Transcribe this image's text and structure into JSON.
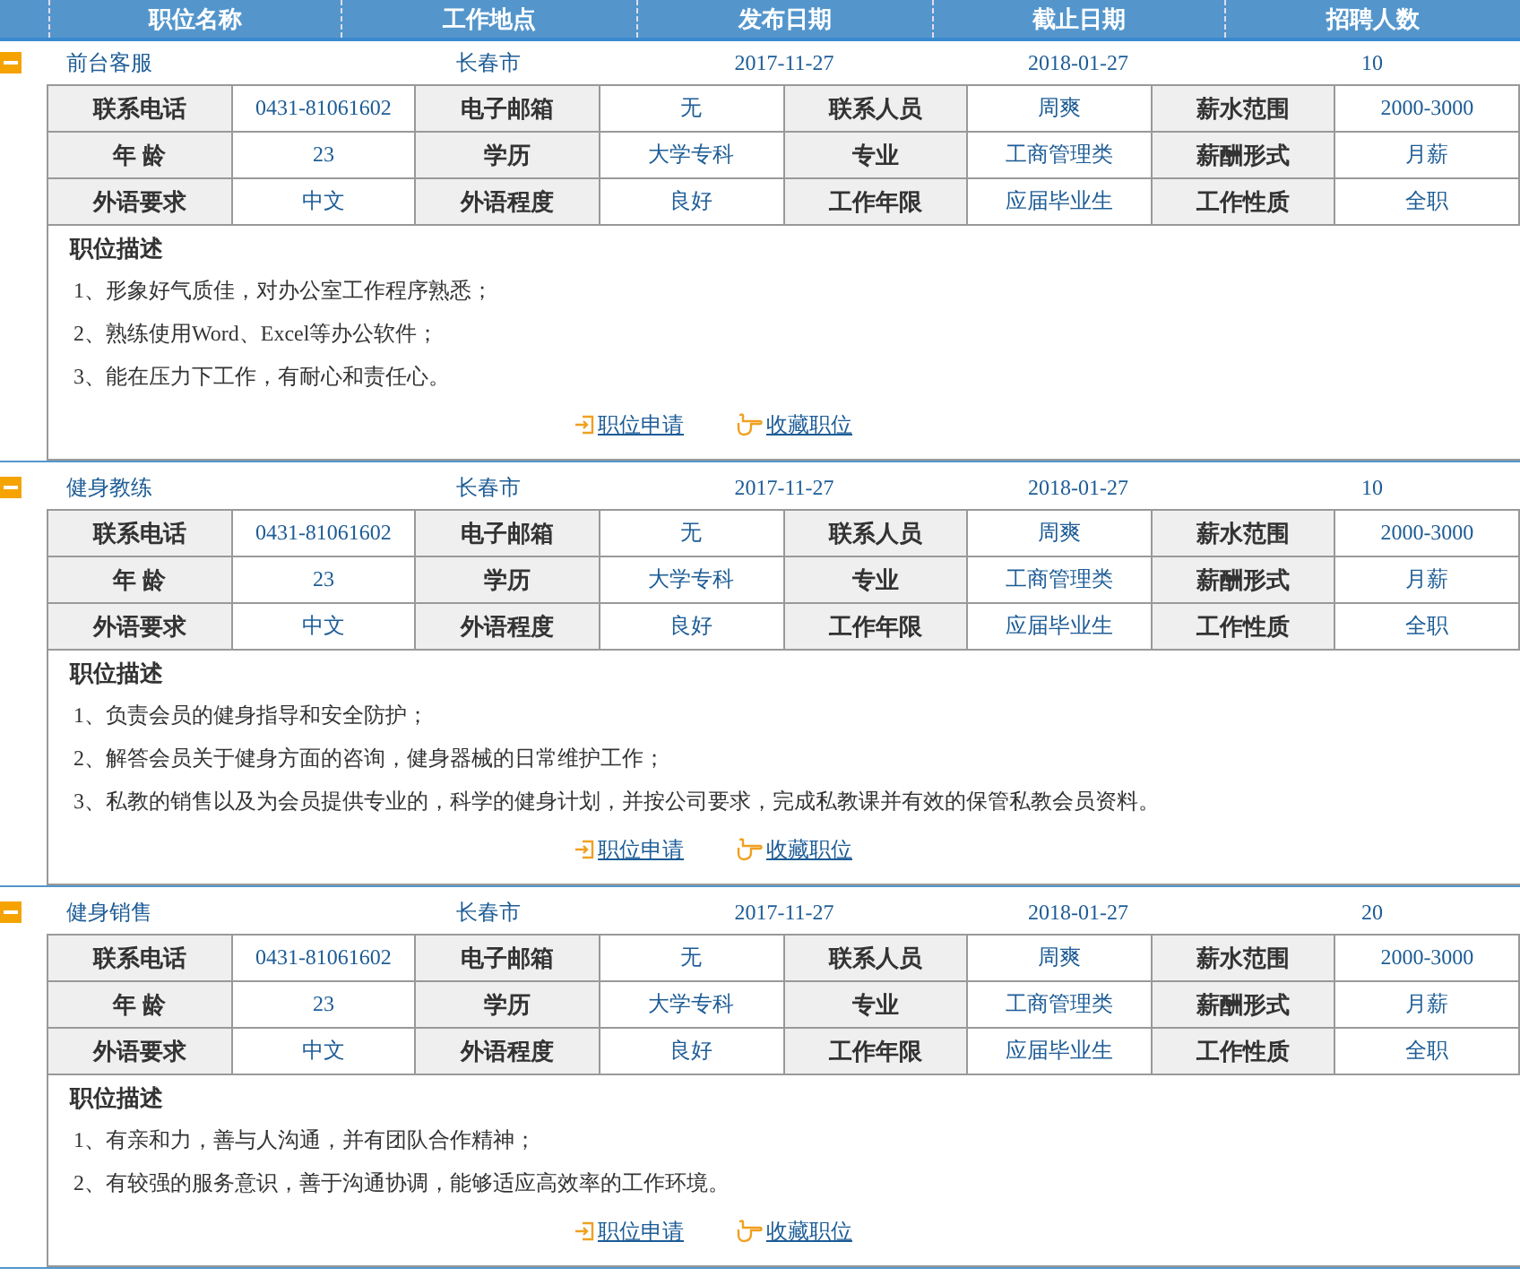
{
  "columns": [
    "职位名称",
    "工作地点",
    "发布日期",
    "截止日期",
    "招聘人数"
  ],
  "jobs": [
    {
      "expanded": true,
      "title": "前台客服",
      "location": "长春市",
      "posted": "2017-11-27",
      "deadline": "2018-01-27",
      "count": "10",
      "fields": [
        {
          "label": "联系电话",
          "value": "0431-81061602"
        },
        {
          "label": "电子邮箱",
          "value": "无"
        },
        {
          "label": "联系人员",
          "value": "周爽"
        },
        {
          "label": "薪水范围",
          "value": "2000-3000"
        },
        {
          "label": "年 龄",
          "value": "23"
        },
        {
          "label": "学历",
          "value": "大学专科"
        },
        {
          "label": "专业",
          "value": "工商管理类"
        },
        {
          "label": "薪酬形式",
          "value": "月薪"
        },
        {
          "label": "外语要求",
          "value": "中文"
        },
        {
          "label": "外语程度",
          "value": "良好"
        },
        {
          "label": "工作年限",
          "value": "应届毕业生"
        },
        {
          "label": "工作性质",
          "value": "全职"
        }
      ],
      "description_title": "职位描述",
      "description": [
        "1、形象好气质佳，对办公室工作程序熟悉；",
        "2、熟练使用Word、Excel等办公软件；",
        "3、能在压力下工作，有耐心和责任心。"
      ],
      "apply": "职位申请",
      "save": "收藏职位"
    },
    {
      "expanded": true,
      "title": "健身教练",
      "location": "长春市",
      "posted": "2017-11-27",
      "deadline": "2018-01-27",
      "count": "10",
      "fields": [
        {
          "label": "联系电话",
          "value": "0431-81061602"
        },
        {
          "label": "电子邮箱",
          "value": "无"
        },
        {
          "label": "联系人员",
          "value": "周爽"
        },
        {
          "label": "薪水范围",
          "value": "2000-3000"
        },
        {
          "label": "年 龄",
          "value": "23"
        },
        {
          "label": "学历",
          "value": "大学专科"
        },
        {
          "label": "专业",
          "value": "工商管理类"
        },
        {
          "label": "薪酬形式",
          "value": "月薪"
        },
        {
          "label": "外语要求",
          "value": "中文"
        },
        {
          "label": "外语程度",
          "value": "良好"
        },
        {
          "label": "工作年限",
          "value": "应届毕业生"
        },
        {
          "label": "工作性质",
          "value": "全职"
        }
      ],
      "description_title": "职位描述",
      "description": [
        "1、负责会员的健身指导和安全防护；",
        "2、解答会员关于健身方面的咨询，健身器械的日常维护工作；",
        "3、私教的销售以及为会员提供专业的，科学的健身计划，并按公司要求，完成私教课并有效的保管私教会员资料。"
      ],
      "apply": "职位申请",
      "save": "收藏职位"
    },
    {
      "expanded": true,
      "title": "健身销售",
      "location": "长春市",
      "posted": "2017-11-27",
      "deadline": "2018-01-27",
      "count": "20",
      "fields": [
        {
          "label": "联系电话",
          "value": "0431-81061602"
        },
        {
          "label": "电子邮箱",
          "value": "无"
        },
        {
          "label": "联系人员",
          "value": "周爽"
        },
        {
          "label": "薪水范围",
          "value": "2000-3000"
        },
        {
          "label": "年 龄",
          "value": "23"
        },
        {
          "label": "学历",
          "value": "大学专科"
        },
        {
          "label": "专业",
          "value": "工商管理类"
        },
        {
          "label": "薪酬形式",
          "value": "月薪"
        },
        {
          "label": "外语要求",
          "value": "中文"
        },
        {
          "label": "外语程度",
          "value": "良好"
        },
        {
          "label": "工作年限",
          "value": "应届毕业生"
        },
        {
          "label": "工作性质",
          "value": "全职"
        }
      ],
      "description_title": "职位描述",
      "description": [
        "1、有亲和力，善与人沟通，并有团队合作精神；",
        "2、有较强的服务意识，善于沟通协调，能够适应高效率的工作环境。"
      ],
      "apply": "职位申请",
      "save": "收藏职位"
    }
  ]
}
